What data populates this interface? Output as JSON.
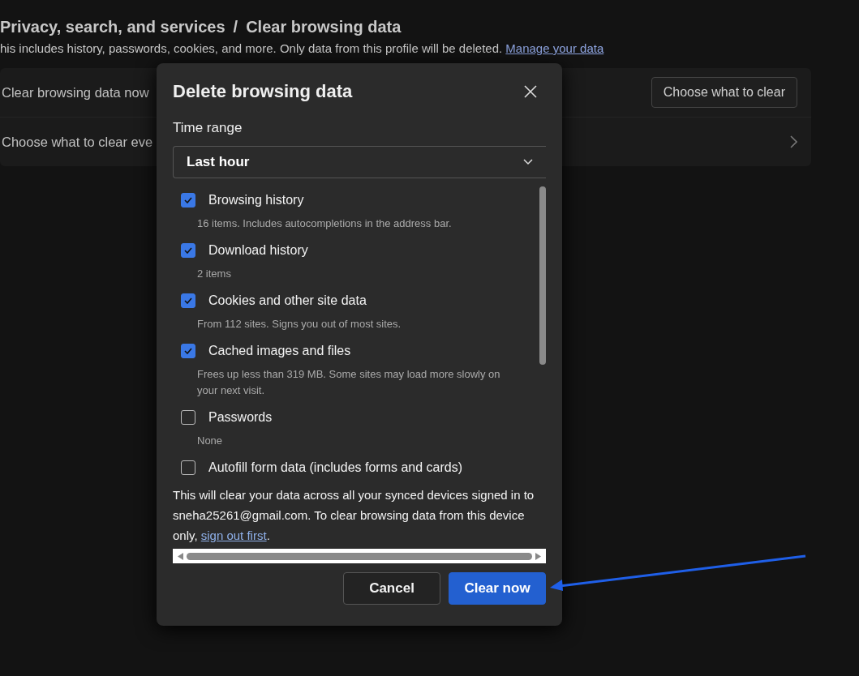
{
  "page": {
    "breadcrumb": "Privacy, search, and services",
    "separator": "/",
    "title": "Clear browsing data",
    "description": "his includes history, passwords, cookies, and more. Only data from this profile will be deleted.",
    "link": "Manage your data"
  },
  "settings": [
    {
      "kind": "button",
      "label": "Clear browsing data now",
      "action": "Choose what to clear"
    },
    {
      "kind": "chevron",
      "label": "Choose what to clear eve"
    }
  ],
  "dialog": {
    "title": "Delete browsing data",
    "time_range_label": "Time range",
    "time_range": "Last hour",
    "options": [
      {
        "label": "Browsing history",
        "detail": "16 items. Includes autocompletions in the address bar.",
        "checked": true
      },
      {
        "label": "Download history",
        "detail": "2 items",
        "checked": true
      },
      {
        "label": "Cookies and other site data",
        "detail": "From 112 sites. Signs you out of most sites.",
        "checked": true
      },
      {
        "label": "Cached images and files",
        "detail": "Frees up less than 319 MB. Some sites may load more slowly on your next visit.",
        "checked": true
      },
      {
        "label": "Passwords",
        "detail": "None",
        "checked": false
      },
      {
        "label": "Autofill form data (includes forms and cards)",
        "checked": false
      }
    ],
    "notice": "This will clear your data across all your synced devices signed in to sneha25261@gmail.com. To clear browsing data from this device only,",
    "notice_link": "sign out first",
    "notice_end": ".",
    "buttons": [
      {
        "label": "Cancel",
        "kind": "secondary"
      },
      {
        "label": "Clear now",
        "kind": "primary"
      }
    ]
  }
}
